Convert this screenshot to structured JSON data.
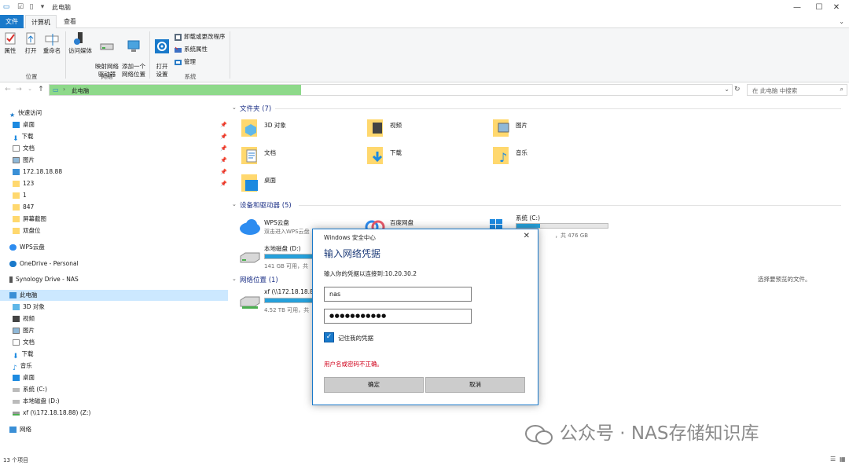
{
  "window": {
    "title": "此电脑",
    "minimize": "—",
    "maximize": "☐",
    "close": "✕"
  },
  "ribbon_tabs": [
    "文件",
    "计算机",
    "查看"
  ],
  "ribbon": {
    "location_group": {
      "label": "位置",
      "properties": "属性",
      "open": "打开",
      "rename": "重命名"
    },
    "network_group": {
      "label": "网络",
      "access_media": "访问媒体",
      "map_drive": "映射网络\n驱动器",
      "add_location": "添加一个\n网络位置"
    },
    "system_group": {
      "label": "系统",
      "open_settings": "打开\n设置",
      "uninstall": "卸载或更改程序",
      "sys_props": "系统属性",
      "manage": "管理"
    }
  },
  "address": {
    "path": "此电脑",
    "search_placeholder": "在 此电脑 中搜索"
  },
  "nav": {
    "quick_access": "快速访问",
    "quick_items": [
      "桌面",
      "下载",
      "文档",
      "图片",
      "172.18.18.88",
      "123",
      "1",
      "847",
      "屏幕截图",
      "双盘位"
    ],
    "wps": "WPS云盘",
    "onedrive": "OneDrive - Personal",
    "synology": "Synology Drive - NAS",
    "this_pc": "此电脑",
    "pc_items": [
      "3D 对象",
      "视频",
      "图片",
      "文档",
      "下载",
      "音乐",
      "桌面",
      "系统 (C:)",
      "本地磁盘 (D:)",
      "xf (\\\\172.18.18.88) (Z:)"
    ],
    "network": "网络"
  },
  "content": {
    "folders_header": "文件夹 (7)",
    "folders": [
      "3D 对象",
      "视频",
      "图片",
      "文档",
      "下载",
      "音乐",
      "桌面"
    ],
    "devices_header": "设备和驱动器 (5)",
    "devices": [
      {
        "name": "WPS云盘",
        "sub": "双击进入WPS云盘"
      },
      {
        "name": "百度网盘",
        "sub": ""
      },
      {
        "name": "系统 (C:)",
        "sub": "，共 476 GB",
        "usage": 0.26
      },
      {
        "name": "本地磁盘 (D:)",
        "sub": "141 GB 可用，共",
        "usage": 0.72
      }
    ],
    "network_header": "网络位置 (1)",
    "network_items": [
      {
        "name": "xf (\\\\172.18.18.88",
        "sub": "4.52 TB 可用，共",
        "usage": 0.75
      }
    ],
    "preview_hint": "选择要预览的文件。"
  },
  "dialog": {
    "title": "Windows 安全中心",
    "heading": "输入网络凭据",
    "prompt": "输入你的凭据以连接到:10.20.30.2",
    "username": "nas",
    "password": "●●●●●●●●●●●",
    "remember": "记住我的凭据",
    "error": "用户名或密码不正确。",
    "ok": "确定",
    "cancel": "取消"
  },
  "status": {
    "items": "13 个项目"
  },
  "watermark": "公众号 · NAS存储知识库",
  "colors": {
    "accent": "#1979ca",
    "address_fill": "#8ed98a",
    "error": "#d0021b",
    "drive_bar": "#26a0da"
  }
}
